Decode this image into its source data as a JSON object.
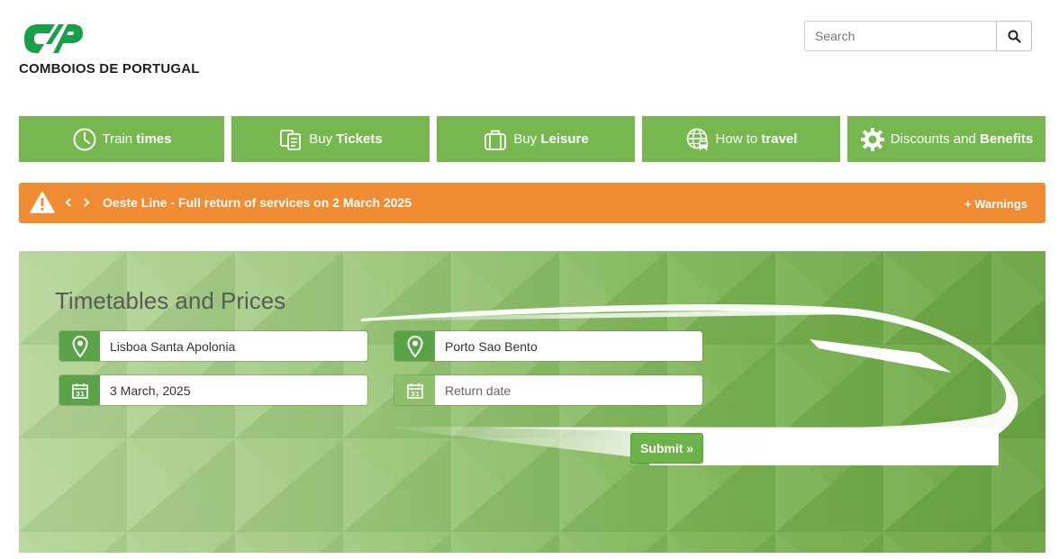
{
  "brand": {
    "name": "COMBOIOS DE PORTUGAL",
    "logo_mark": "CP",
    "primary_green": "#76b84f",
    "logo_green": "#17a04a",
    "alert_orange": "#ef8c34"
  },
  "search": {
    "placeholder": "Search",
    "value": "",
    "button_icon": "search-icon"
  },
  "nav": [
    {
      "light": "Train ",
      "bold": "times",
      "icon": "clock-icon"
    },
    {
      "light": "Buy ",
      "bold": "Tickets",
      "icon": "tickets-icon"
    },
    {
      "light": "Buy ",
      "bold": "Leisure",
      "icon": "luggage-icon"
    },
    {
      "light": "How to ",
      "bold": "travel",
      "icon": "globe-train-icon"
    },
    {
      "light": "Discounts and ",
      "bold": "Benefits",
      "icon": "gear-badge-icon"
    }
  ],
  "alert": {
    "icon": "warning-icon",
    "message": "Oeste Line - Full return of services on 2 March 2025",
    "more_link": "+ Warnings"
  },
  "timetable": {
    "title": "Timetables and Prices",
    "origin": {
      "value": "Lisboa Santa Apolonia",
      "icon": "location-pin-icon"
    },
    "destination": {
      "value": "Porto Sao Bento",
      "icon": "location-pin-icon"
    },
    "departure_date": {
      "value": "3 March, 2025",
      "icon": "calendar-icon"
    },
    "return_date": {
      "placeholder": "Return date",
      "value": "",
      "icon": "calendar-icon"
    },
    "submit_label": "Submit »"
  }
}
